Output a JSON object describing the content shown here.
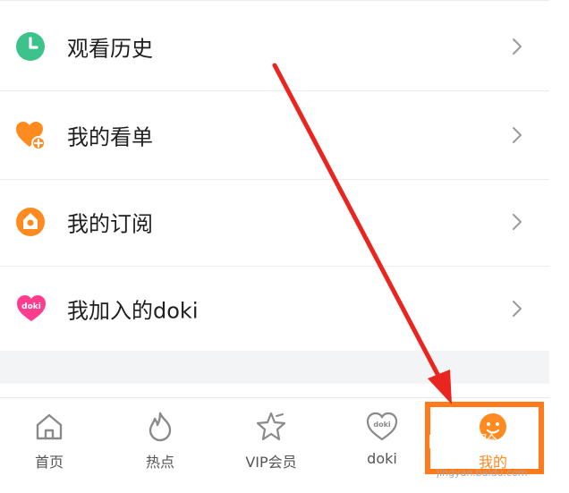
{
  "menu": {
    "items": [
      {
        "label": "观看历史",
        "icon": "clock-icon"
      },
      {
        "label": "我的看单",
        "icon": "heart-plus-icon"
      },
      {
        "label": "我的订阅",
        "icon": "subscribe-icon"
      },
      {
        "label": "我加入的doki",
        "icon": "doki-heart-icon"
      }
    ]
  },
  "icons": {
    "doki_heart_text": "doki",
    "tab_doki_text": "doki"
  },
  "tabbar": {
    "tabs": [
      {
        "label": "首页",
        "icon": "home-icon",
        "active": false
      },
      {
        "label": "热点",
        "icon": "flame-icon",
        "active": false
      },
      {
        "label": "VIP会员",
        "icon": "star-icon",
        "active": false
      },
      {
        "label": "doki",
        "icon": "doki-heart-icon",
        "active": false
      },
      {
        "label": "我的",
        "icon": "smiley-icon",
        "active": true
      }
    ]
  },
  "watermark": {
    "text": "Bai 经验",
    "sub": "jingyan.baidu.com"
  },
  "colors": {
    "green": "#3cc28a",
    "orange": "#ff8a1f",
    "pink": "#ff3d8f",
    "highlight": "#ff7a1a",
    "arrow": "#e8261f"
  }
}
